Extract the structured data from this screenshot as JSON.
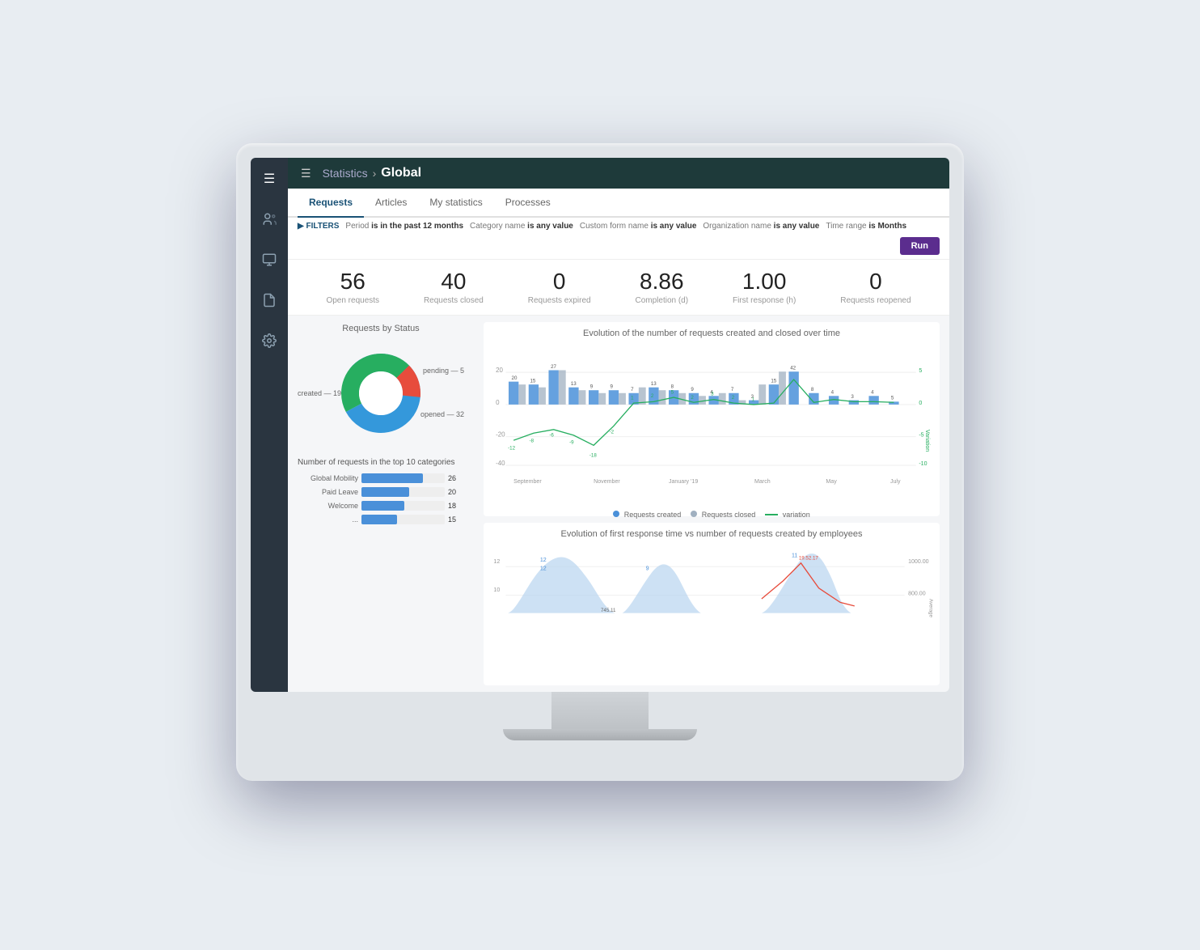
{
  "header": {
    "hamburger": "☰",
    "breadcrumb_parent": "Statistics",
    "breadcrumb_separator": "›",
    "breadcrumb_current": "Global"
  },
  "tabs": [
    {
      "label": "Requests",
      "active": true
    },
    {
      "label": "Articles",
      "active": false
    },
    {
      "label": "My statistics",
      "active": false
    },
    {
      "label": "Processes",
      "active": false
    }
  ],
  "filters": {
    "label": "▶ FILTERS",
    "items": [
      {
        "text": "Period is in the past 12 months"
      },
      {
        "text": "Category name is any value"
      },
      {
        "text": "Custom form name is any value"
      },
      {
        "text": "Organization name is any value"
      },
      {
        "text": "Time range is Months"
      }
    ]
  },
  "run_button": "Run",
  "stats": [
    {
      "value": "56",
      "label": "Open requests"
    },
    {
      "value": "40",
      "label": "Requests closed"
    },
    {
      "value": "0",
      "label": "Requests expired"
    },
    {
      "value": "8.86",
      "label": "Completion (d)"
    },
    {
      "value": "1.00",
      "label": "First response (h)"
    },
    {
      "value": "0",
      "label": "Requests reopened"
    }
  ],
  "donut_chart": {
    "title": "Requests by Status",
    "legend": [
      {
        "label": "pending — 5",
        "color": "#e74c3c"
      },
      {
        "label": "created — 19",
        "color": "#27ae60"
      },
      {
        "label": "opened — 32",
        "color": "#3498db"
      }
    ]
  },
  "evolution_chart": {
    "title": "Evolution of the number of requests created and closed over time",
    "x_labels": [
      "September",
      "November",
      "January '19",
      "March",
      "May",
      "July"
    ],
    "bar_data_created": [
      20,
      15,
      27,
      13,
      9,
      9,
      7,
      13,
      8,
      9,
      4,
      7,
      3,
      15,
      42,
      8,
      4,
      3,
      4,
      5
    ],
    "bar_data_closed": [
      15,
      13,
      27,
      9,
      9,
      7,
      13,
      8,
      9,
      4,
      7,
      3,
      15,
      42,
      8,
      4,
      3,
      4,
      5,
      1
    ],
    "variation_data": [
      -12,
      -8,
      -6,
      -9,
      -18,
      -2,
      1,
      2,
      5,
      2,
      3,
      2,
      1,
      0
    ],
    "legend": [
      "Requests created",
      "Requests closed",
      "variation"
    ]
  },
  "top10_chart": {
    "title": "Number of requests in the top 10 categories",
    "bars": [
      {
        "label": "Global Mobility",
        "value": 26,
        "max": 35
      },
      {
        "label": "Paid Leave",
        "value": 20,
        "max": 35
      },
      {
        "label": "Welcome",
        "value": 18,
        "max": 35
      },
      {
        "label": "...",
        "value": 15,
        "max": 35
      }
    ]
  },
  "response_chart": {
    "title": "Evolution of first response time vs number of requests created by employees",
    "y_labels": [
      "1000.00",
      "800.00"
    ],
    "x_labels": [
      "",
      "",
      "",
      "",
      "",
      ""
    ]
  },
  "sidebar_icons": [
    "☰",
    "👥",
    "🖥",
    "📄",
    "🔧",
    "⚙"
  ]
}
